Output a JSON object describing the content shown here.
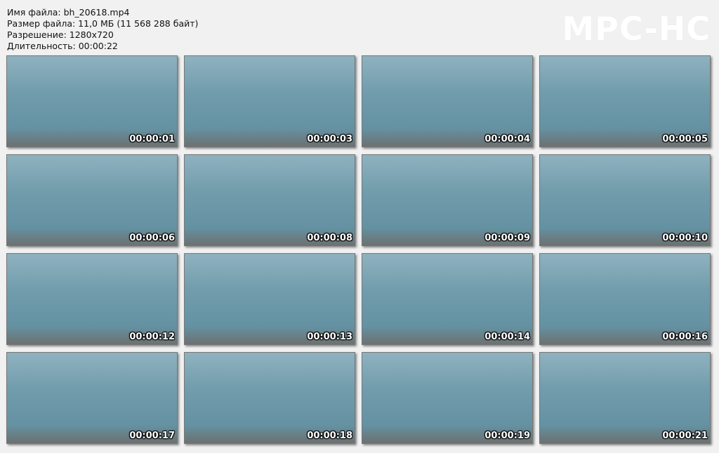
{
  "info": {
    "filename": "Имя файла: bh_20618.mp4",
    "filesize": "Размер файла: 11,0 МБ (11 568 288 байт)",
    "resolution": "Разрешение: 1280x720",
    "duration": "Длительность: 00:00:22"
  },
  "logo": "MPC-HC",
  "thumbs": [
    {
      "time": "00:00:01"
    },
    {
      "time": "00:00:03"
    },
    {
      "time": "00:00:04"
    },
    {
      "time": "00:00:05"
    },
    {
      "time": "00:00:06"
    },
    {
      "time": "00:00:08"
    },
    {
      "time": "00:00:09"
    },
    {
      "time": "00:00:10"
    },
    {
      "time": "00:00:12"
    },
    {
      "time": "00:00:13"
    },
    {
      "time": "00:00:14"
    },
    {
      "time": "00:00:16"
    },
    {
      "time": "00:00:17"
    },
    {
      "time": "00:00:18"
    },
    {
      "time": "00:00:19"
    },
    {
      "time": "00:00:21"
    }
  ]
}
